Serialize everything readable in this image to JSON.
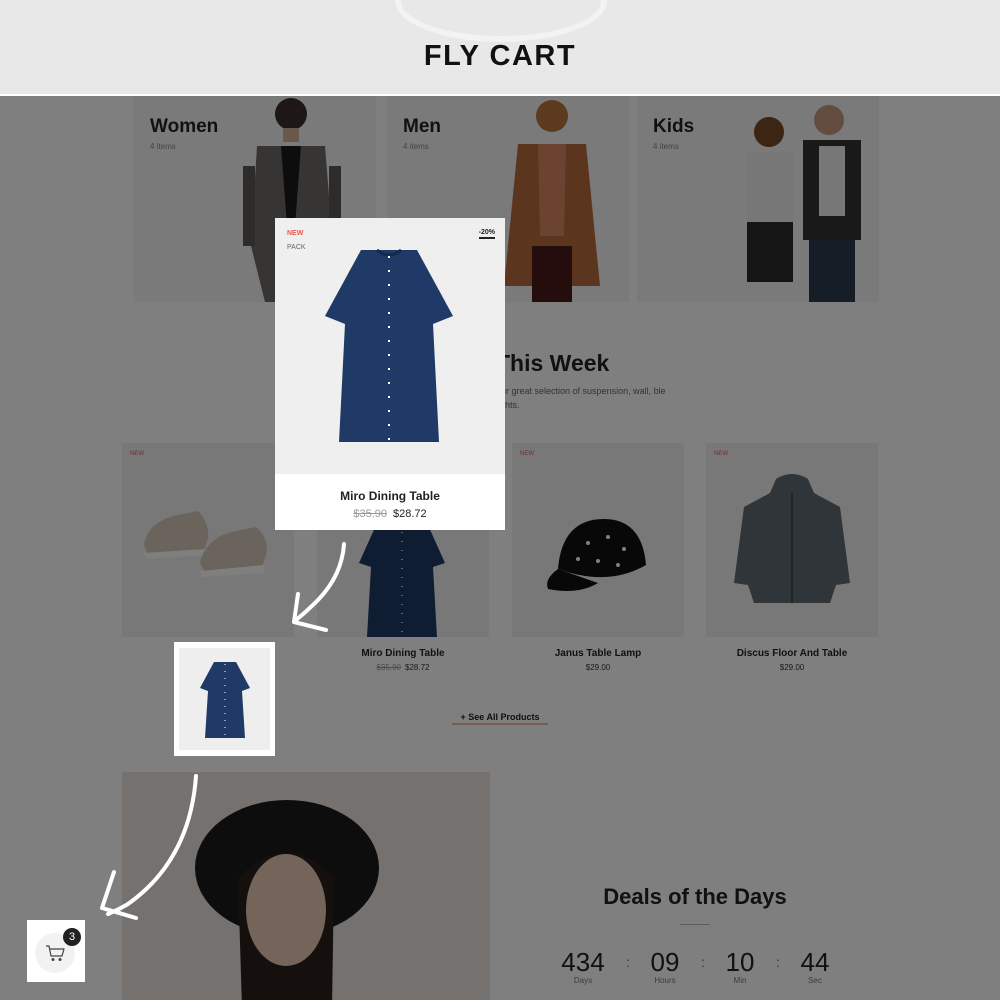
{
  "header": {
    "title": "FLY CART"
  },
  "categories": [
    {
      "title": "Women",
      "count": "4 items"
    },
    {
      "title": "Men",
      "count": "4 items"
    },
    {
      "title": "Kids",
      "count": "4 items"
    }
  ],
  "section": {
    "title": "This Week",
    "subtitle": "our great selection of suspension, wall, ble lights."
  },
  "products": [
    {
      "badge": "NEW",
      "name": "",
      "price": "",
      "old_price": ""
    },
    {
      "badge": "",
      "name": "Miro Dining Table",
      "price": "$28.72",
      "old_price": "$35.90"
    },
    {
      "badge": "NEW",
      "name": "Janus Table Lamp",
      "price": "$29.00",
      "old_price": ""
    },
    {
      "badge": "NEW",
      "name": "Discus Floor And Table",
      "price": "$29.00",
      "old_price": ""
    }
  ],
  "see_all": "+ See All Products",
  "popup": {
    "badge_new": "NEW",
    "badge_pack": "PACK",
    "discount": "-20%",
    "name": "Miro Dining Table",
    "old_price": "$35.90",
    "price": "$28.72"
  },
  "deals": {
    "title": "Deals of the Days",
    "countdown": [
      {
        "value": "434",
        "label": "Days"
      },
      {
        "value": "09",
        "label": "Hours"
      },
      {
        "value": "10",
        "label": "Min"
      },
      {
        "value": "44",
        "label": "Sec"
      }
    ]
  },
  "cart": {
    "count": "3",
    "icon": "cart-icon"
  },
  "colors": {
    "accent_red": "#e55555",
    "overlay": "rgba(0,0,0,0.5)",
    "dress_navy": "#1f3a66"
  }
}
